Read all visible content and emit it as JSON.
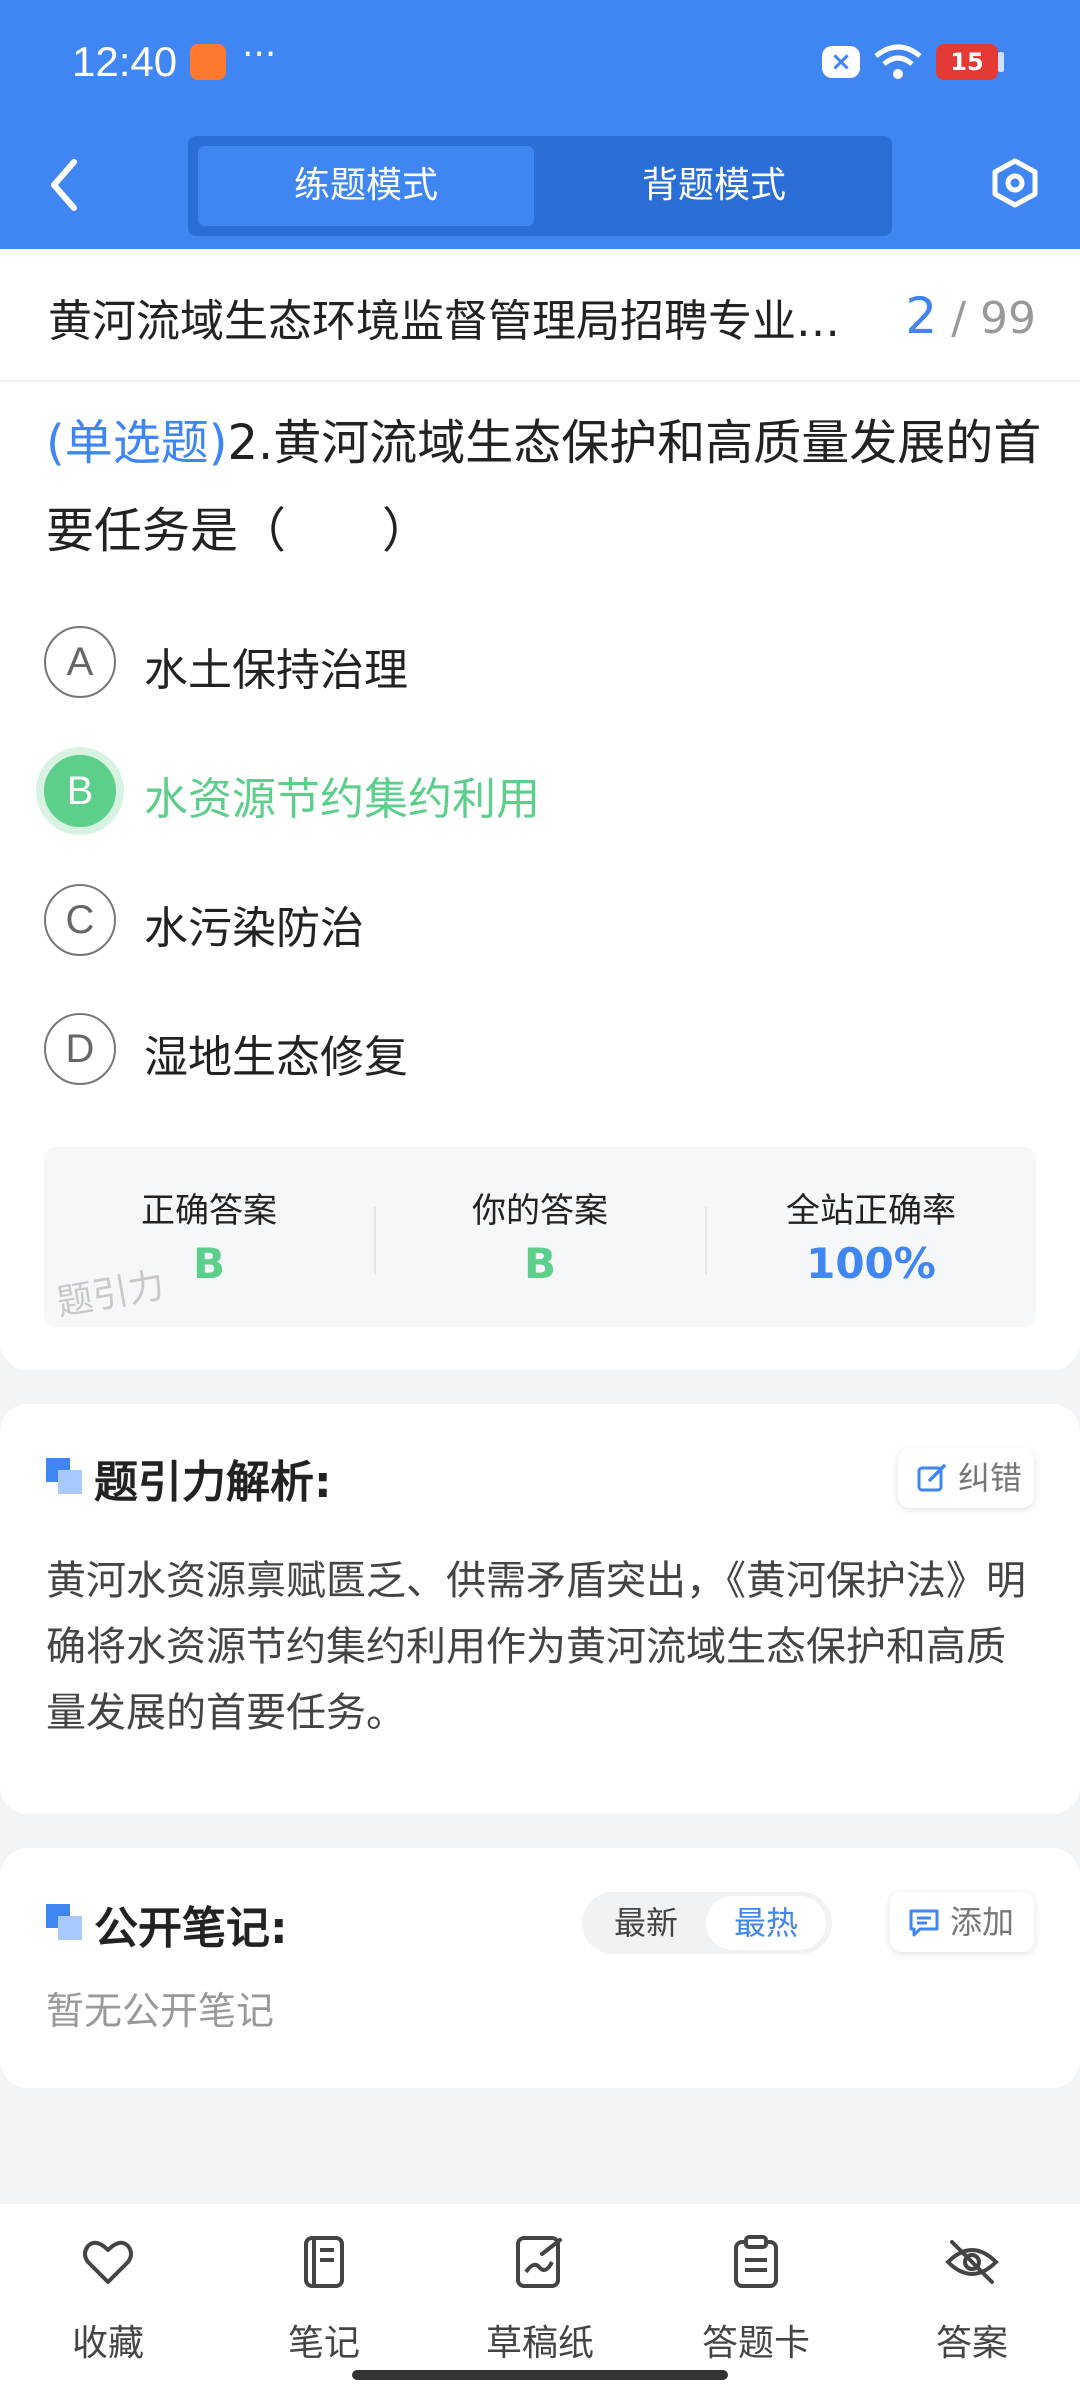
{
  "status_bar": {
    "time": "12:40",
    "dots": "···",
    "battery": "15"
  },
  "header": {
    "modes": [
      "练题模式",
      "背题模式"
    ],
    "active_mode_index": 0
  },
  "question": {
    "paper_title": "黄河流域生态环境监督管理局招聘专业…",
    "current": "2",
    "total": "/ 99",
    "type": "(单选题)",
    "text": "2.黄河流域生态保护和高质量发展的首要任务是（　　）",
    "options": [
      {
        "letter": "A",
        "text": "水土保持治理",
        "selected": false
      },
      {
        "letter": "B",
        "text": "水资源节约集约利用",
        "selected": true
      },
      {
        "letter": "C",
        "text": "水污染防治",
        "selected": false
      },
      {
        "letter": "D",
        "text": "湿地生态修复",
        "selected": false
      }
    ],
    "stats": {
      "correct_label": "正确答案",
      "correct_value": "B",
      "yours_label": "你的答案",
      "yours_value": "B",
      "rate_label": "全站正确率",
      "rate_value": "100%"
    },
    "watermark": "题引力"
  },
  "analysis": {
    "title": "题引力解析:",
    "report_label": "纠错",
    "text": "黄河水资源禀赋匮乏、供需矛盾突出，《黄河保护法》明确将水资源节约集约利用作为黄河流域生态保护和高质量发展的首要任务。"
  },
  "notes": {
    "title": "公开笔记:",
    "sort_latest": "最新",
    "sort_hot": "最热",
    "add_label": "添加",
    "empty": "暂无公开笔记"
  },
  "bottom_bar": {
    "items": [
      "收藏",
      "笔记",
      "草稿纸",
      "答题卡",
      "答案"
    ]
  },
  "colors": {
    "primary": "#3f86f2",
    "correct": "#5ccf8a"
  }
}
